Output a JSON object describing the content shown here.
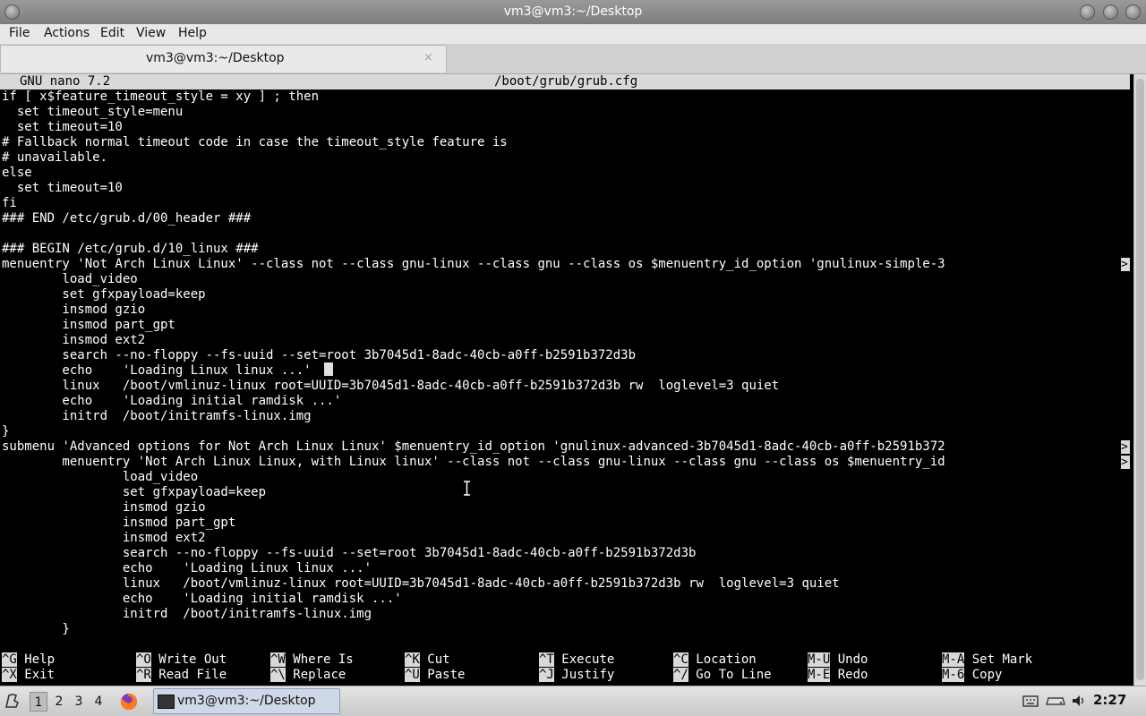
{
  "window": {
    "title": "vm3@vm3:~/Desktop"
  },
  "menubar": {
    "items": [
      "File",
      "Actions",
      "Edit",
      "View",
      "Help"
    ]
  },
  "tab": {
    "label": "vm3@vm3:~/Desktop",
    "close": "×"
  },
  "nano": {
    "version": "GNU nano 7.2",
    "filename": "/boot/grub/grub.cfg",
    "lines": [
      "if [ x$feature_timeout_style = xy ] ; then",
      "  set timeout_style=menu",
      "  set timeout=10",
      "# Fallback normal timeout code in case the timeout_style feature is",
      "# unavailable.",
      "else",
      "  set timeout=10",
      "fi",
      "### END /etc/grub.d/00_header ###",
      "",
      "### BEGIN /etc/grub.d/10_linux ###",
      "menuentry 'Not Arch Linux Linux' --class not --class gnu-linux --class gnu --class os $menuentry_id_option 'gnulinux-simple-3",
      "        load_video",
      "        set gfxpayload=keep",
      "        insmod gzio",
      "        insmod part_gpt",
      "        insmod ext2",
      "        search --no-floppy --fs-uuid --set=root 3b7045d1-8adc-40cb-a0ff-b2591b372d3b",
      "        echo    'Loading Linux linux ...'",
      "        linux   /boot/vmlinuz-linux root=UUID=3b7045d1-8adc-40cb-a0ff-b2591b372d3b rw  loglevel=3 quiet",
      "        echo    'Loading initial ramdisk ...'",
      "        initrd  /boot/initramfs-linux.img",
      "}",
      "submenu 'Advanced options for Not Arch Linux Linux' $menuentry_id_option 'gnulinux-advanced-3b7045d1-8adc-40cb-a0ff-b2591b372",
      "        menuentry 'Not Arch Linux Linux, with Linux linux' --class not --class gnu-linux --class gnu --class os $menuentry_id",
      "                load_video",
      "                set gfxpayload=keep",
      "                insmod gzio",
      "                insmod part_gpt",
      "                insmod ext2",
      "                search --no-floppy --fs-uuid --set=root 3b7045d1-8adc-40cb-a0ff-b2591b372d3b",
      "                echo    'Loading Linux linux ...'",
      "                linux   /boot/vmlinuz-linux root=UUID=3b7045d1-8adc-40cb-a0ff-b2591b372d3b rw  loglevel=3 quiet",
      "                echo    'Loading initial ramdisk ...'",
      "                initrd  /boot/initramfs-linux.img",
      "        }"
    ],
    "overflow_marker": ">",
    "shortcuts_row1": [
      {
        "key": "^G",
        "label": "Help"
      },
      {
        "key": "^O",
        "label": "Write Out"
      },
      {
        "key": "^W",
        "label": "Where Is"
      },
      {
        "key": "^K",
        "label": "Cut"
      },
      {
        "key": "^T",
        "label": "Execute"
      },
      {
        "key": "^C",
        "label": "Location"
      },
      {
        "key": "M-U",
        "label": "Undo"
      },
      {
        "key": "M-A",
        "label": "Set Mark"
      }
    ],
    "shortcuts_row2": [
      {
        "key": "^X",
        "label": "Exit"
      },
      {
        "key": "^R",
        "label": "Read File"
      },
      {
        "key": "^\\",
        "label": "Replace"
      },
      {
        "key": "^U",
        "label": "Paste"
      },
      {
        "key": "^J",
        "label": "Justify"
      },
      {
        "key": "^/",
        "label": "Go To Line"
      },
      {
        "key": "M-E",
        "label": "Redo"
      },
      {
        "key": "M-6",
        "label": "Copy"
      }
    ]
  },
  "taskbar": {
    "workspaces": [
      "1",
      "2",
      "3",
      "4"
    ],
    "task_label": "vm3@vm3:~/Desktop",
    "clock": "2:27"
  },
  "colors": {
    "terminal_bg": "#000000",
    "terminal_fg": "#ffffff",
    "header_bg": "#d9d9d9"
  }
}
